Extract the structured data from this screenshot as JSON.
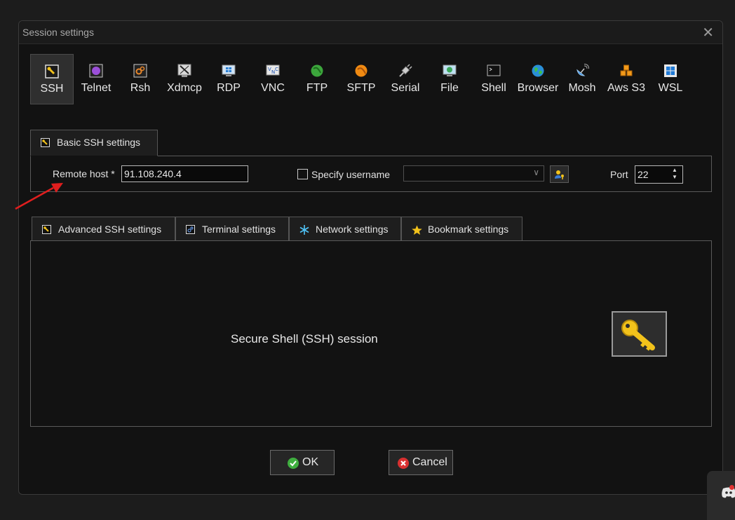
{
  "window": {
    "title": "Session settings",
    "close_symbol": "✕"
  },
  "protocols": [
    {
      "label": "SSH",
      "icon": "ssh-key-icon",
      "active": true
    },
    {
      "label": "Telnet",
      "icon": "telnet-icon",
      "active": false
    },
    {
      "label": "Rsh",
      "icon": "rsh-icon",
      "active": false
    },
    {
      "label": "Xdmcp",
      "icon": "xdmcp-icon",
      "active": false
    },
    {
      "label": "RDP",
      "icon": "rdp-icon",
      "active": false
    },
    {
      "label": "VNC",
      "icon": "vnc-icon",
      "active": false
    },
    {
      "label": "FTP",
      "icon": "ftp-icon",
      "active": false
    },
    {
      "label": "SFTP",
      "icon": "sftp-icon",
      "active": false
    },
    {
      "label": "Serial",
      "icon": "serial-plug-icon",
      "active": false
    },
    {
      "label": "File",
      "icon": "file-monitor-icon",
      "active": false
    },
    {
      "label": "Shell",
      "icon": "terminal-icon",
      "active": false
    },
    {
      "label": "Browser",
      "icon": "globe-icon",
      "active": false
    },
    {
      "label": "Mosh",
      "icon": "satellite-icon",
      "active": false
    },
    {
      "label": "Aws S3",
      "icon": "aws-cubes-icon",
      "active": false
    },
    {
      "label": "WSL",
      "icon": "windows-icon",
      "active": false
    }
  ],
  "basic": {
    "tab_label": "Basic SSH settings",
    "remote_host_label": "Remote host *",
    "remote_host_value": "91.108.240.4",
    "specify_username_label": "Specify username",
    "specify_username_checked": false,
    "username_value": "",
    "port_label": "Port",
    "port_value": "22"
  },
  "lower_tabs": [
    {
      "label": "Advanced SSH settings",
      "icon": "wrench-icon"
    },
    {
      "label": "Terminal settings",
      "icon": "terminal-settings-icon"
    },
    {
      "label": "Network settings",
      "icon": "network-star-icon"
    },
    {
      "label": "Bookmark settings",
      "icon": "star-icon"
    }
  ],
  "description": "Secure Shell (SSH) session",
  "buttons": {
    "ok": "OK",
    "cancel": "Cancel"
  },
  "colors": {
    "annotation_arrow": "#e01e1e",
    "ok_icon": "#3fae3f",
    "cancel_icon": "#d93030",
    "key_gold": "#f2c21b"
  }
}
